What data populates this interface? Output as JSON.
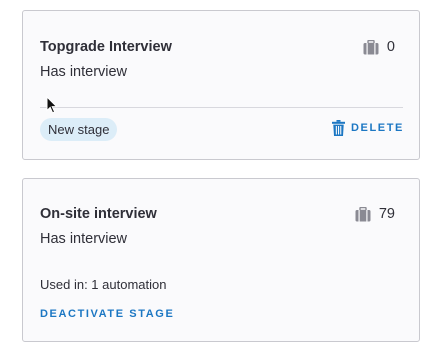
{
  "stages": [
    {
      "title": "Topgrade Interview",
      "subtitle": "Has interview",
      "count": "0",
      "badge": "New stage",
      "delete_label": "DELETE"
    },
    {
      "title": "On-site interview",
      "subtitle": "Has interview",
      "count": "79",
      "used_in": "Used in: 1 automation",
      "deactivate_label": "DEACTIVATE STAGE"
    }
  ],
  "icons": {
    "count": "briefcase-icon",
    "delete": "trash-icon",
    "cursor": "mouse-pointer-icon"
  },
  "colors": {
    "accent": "#1c77c3",
    "badge_bg": "#dcedf8",
    "card_border": "#c9c9cf",
    "icon_gray": "#8a8a93"
  }
}
